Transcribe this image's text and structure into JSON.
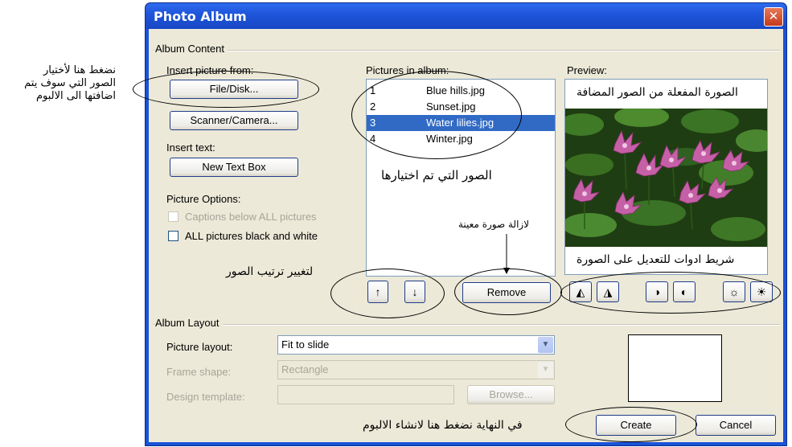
{
  "window": {
    "title": "Photo Album",
    "close_glyph": "✕"
  },
  "album_content": {
    "group_title": "Album Content",
    "insert_picture_label": "Insert picture from:",
    "file_disk_button": "File/Disk...",
    "scanner_button": "Scanner/Camera...",
    "insert_text_label": "Insert text:",
    "new_text_box_button": "New Text Box",
    "picture_options_label": "Picture Options:",
    "captions_option": "Captions below ALL pictures",
    "black_white_option": "ALL pictures black and white",
    "pictures_in_album_label": "Pictures in album:",
    "pictures": [
      {
        "num": "1",
        "name": "Blue hills.jpg",
        "selected": false
      },
      {
        "num": "2",
        "name": "Sunset.jpg",
        "selected": false
      },
      {
        "num": "3",
        "name": "Water lilies.jpg",
        "selected": true
      },
      {
        "num": "4",
        "name": "Winter.jpg",
        "selected": false
      }
    ],
    "move_up_glyph": "↑",
    "move_down_glyph": "↓",
    "remove_button": "Remove",
    "preview_label": "Preview:",
    "tools": [
      "rotate-left-icon",
      "rotate-right-icon",
      "contrast-up-icon",
      "contrast-down-icon",
      "brightness-up-icon",
      "brightness-down-icon"
    ]
  },
  "album_layout": {
    "group_title": "Album Layout",
    "picture_layout_label": "Picture layout:",
    "picture_layout_value": "Fit to slide",
    "frame_shape_label": "Frame shape:",
    "frame_shape_value": "Rectangle",
    "design_template_label": "Design template:",
    "design_template_value": "",
    "browse_button": "Browse..."
  },
  "footer": {
    "create_button": "Create",
    "cancel_button": "Cancel"
  },
  "annotations": {
    "insert_note": [
      "نضغط هنا لأختيار",
      "الصور التي سوف يتم",
      "اضافتها الى الالبوم"
    ],
    "selected_note": "الصور التي تم اختيارها",
    "preview_top_note": "الصورة المفعلة من الصور المضافة",
    "preview_bottom_note": "شريط ادوات للتعديل على الصورة",
    "remove_note": "لازالة صورة معينة",
    "order_note": "لتغيير ترتيب الصور",
    "create_note": "في النهاية نضغط هنا لانشاء الالبوم"
  },
  "colors": {
    "title_blue": "#1f56dc",
    "selection": "#316ac5",
    "dialog_bg": "#ece9d8",
    "close_red": "#d9502a"
  }
}
